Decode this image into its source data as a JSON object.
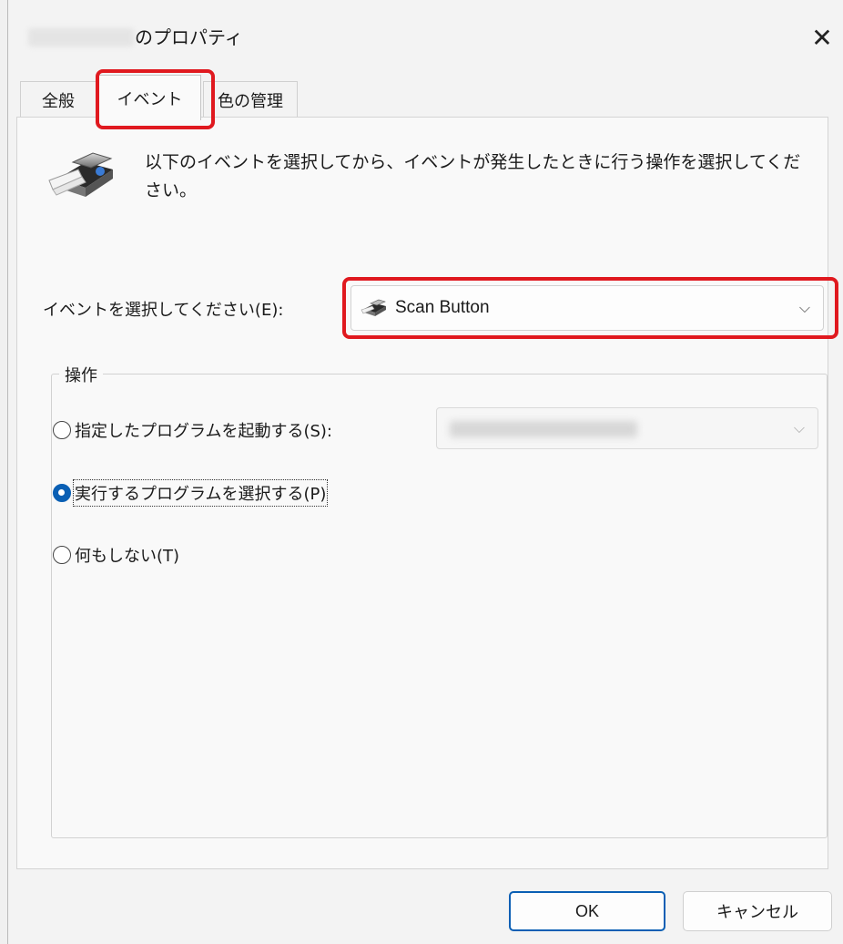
{
  "window": {
    "title_suffix": "のプロパティ",
    "close_glyph": "✕"
  },
  "tabs": [
    {
      "label": "全般",
      "active": false
    },
    {
      "label": "イベント",
      "active": true
    },
    {
      "label": "色の管理",
      "active": false
    }
  ],
  "description": "以下のイベントを選択してから、イベントが発生したときに行う操作を選択してください。",
  "event": {
    "label": "イベントを選択してください(E):",
    "selected": "Scan Button",
    "icon": "scanner-icon"
  },
  "actions": {
    "group_label": "操作",
    "options": [
      {
        "label": "指定したプログラムを起動する(S):",
        "checked": false
      },
      {
        "label": "実行するプログラムを選択する(P)",
        "checked": true
      },
      {
        "label": "何もしない(T)",
        "checked": false
      }
    ]
  },
  "buttons": {
    "ok": "OK",
    "cancel": "キャンセル"
  },
  "colors": {
    "highlight": "#e0191f",
    "accent": "#0a5fb4"
  }
}
